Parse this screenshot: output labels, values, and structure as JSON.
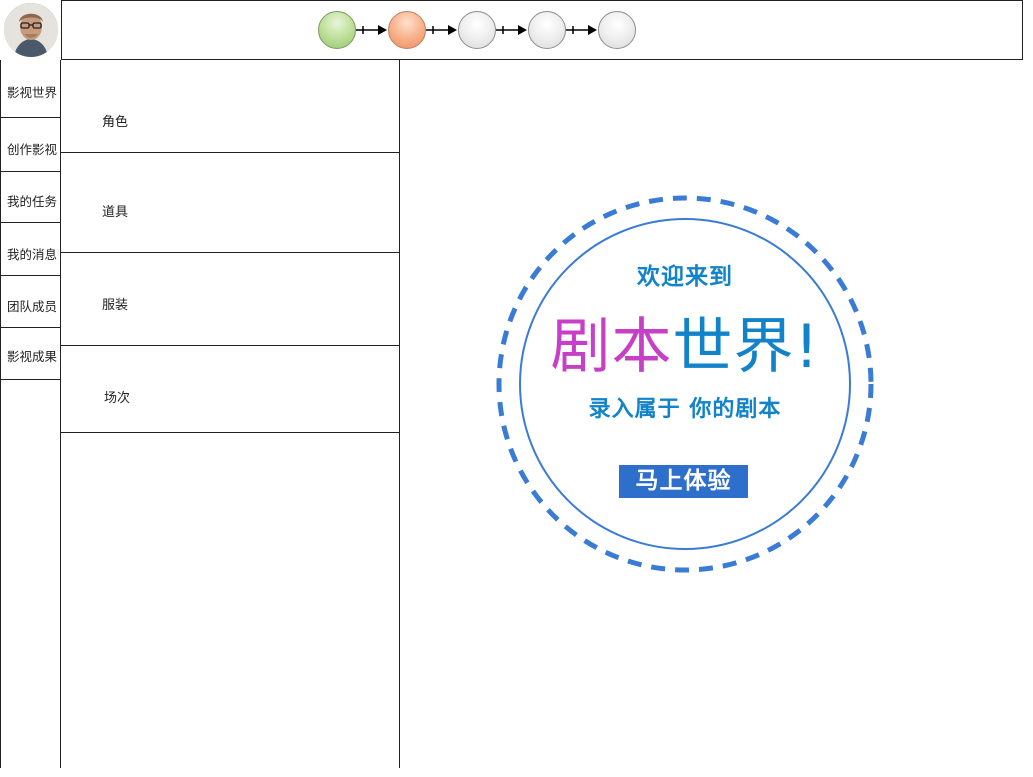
{
  "user": {
    "avatar_icon": "user-avatar"
  },
  "progress": {
    "steps": [
      {
        "state": "done",
        "color": "#93c66a"
      },
      {
        "state": "current",
        "color": "#ef8a5a"
      },
      {
        "state": "pending",
        "color": "#d9d9d9"
      },
      {
        "state": "pending",
        "color": "#d9d9d9"
      },
      {
        "state": "pending",
        "color": "#d9d9d9"
      }
    ],
    "connector_icon": "arrow-right-icon"
  },
  "sidebar": {
    "items": [
      {
        "label": "影视世界"
      },
      {
        "label": "创作影视"
      },
      {
        "label": "我的任务"
      },
      {
        "label": "我的消息"
      },
      {
        "label": "团队成员"
      },
      {
        "label": "影视成果"
      }
    ]
  },
  "categories": {
    "items": [
      {
        "label": "角色"
      },
      {
        "label": "道具"
      },
      {
        "label": "服装"
      },
      {
        "label": "场次"
      }
    ]
  },
  "welcome": {
    "line1": "欢迎来到",
    "title_part1": "剧本",
    "title_part2": "世界!",
    "line3": "录入属于 你的剧本",
    "button_label": "马上体验",
    "colors": {
      "accent": "#1283c9",
      "pink": "#c83fc7",
      "button": "#2f6fcc",
      "ring": "#3a7bd5"
    }
  }
}
